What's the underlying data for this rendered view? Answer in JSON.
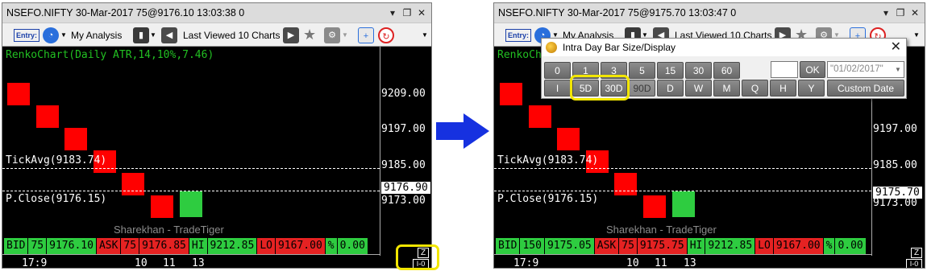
{
  "left": {
    "title": "NSEFO.NIFTY 30-Mar-2017 75@9176.10 13:03:38 0",
    "study_label": "RenkoChart(Daily ATR,14,10%,7.46)",
    "y_labels": [
      "9209.00",
      "9197.00",
      "9185.00",
      "9173.00"
    ],
    "price_marker": "9176.90",
    "tick_avg": "TickAvg(9183.74)",
    "prev_close": "P.Close(9176.15)",
    "quote": {
      "bid_label": "BID",
      "bid_qty": "75",
      "bid_price": "9176.10",
      "ask_label": "ASK",
      "ask_qty": "75",
      "ask_price": "9176.85",
      "hi_label": "HI",
      "hi_price": "9212.85",
      "lo_label": "LO",
      "lo_price": "9167.00",
      "pct_label": "%",
      "pct_value": "0.00"
    },
    "x_labels": [
      "17:9",
      "10",
      "11",
      "13"
    ],
    "z_label": "Z",
    "interval_label": "I-0"
  },
  "right": {
    "title": "NSEFO.NIFTY 30-Mar-2017 75@9175.70 13:03:47 0",
    "study_label": "RenkoCh",
    "y_labels": [
      "9197.00",
      "9185.00",
      "9173.00"
    ],
    "price_marker": "9175.70",
    "tick_avg": "TickAvg(9183.74)",
    "prev_close": "P.Close(9176.15)",
    "quote": {
      "bid_label": "BID",
      "bid_qty": "150",
      "bid_price": "9175.05",
      "ask_label": "ASK",
      "ask_qty": "75",
      "ask_price": "9175.75",
      "hi_label": "HI",
      "hi_price": "9212.85",
      "lo_label": "LO",
      "lo_price": "9167.00",
      "pct_label": "%",
      "pct_value": "0.00"
    },
    "x_labels": [
      "17:9",
      "10",
      "11",
      "13"
    ],
    "z_label": "Z",
    "interval_label": "I-0"
  },
  "toolbar": {
    "entry_label": "Entry:",
    "analysis_label": "My Analysis",
    "viewed_label": "Last Viewed 10 Charts",
    "window_controls": [
      "▾",
      "❐",
      "✕"
    ]
  },
  "watermark": "Sharekhan - TradeTiger",
  "dialog": {
    "title": "Intra Day Bar Size/Display",
    "close_label": "✕",
    "row1": [
      "0",
      "1",
      "3",
      "5",
      "15",
      "30",
      "60"
    ],
    "ok_label": "OK",
    "date_value": "\"01/02/2017\"",
    "row2": [
      "I",
      "5D",
      "30D",
      "90D",
      "D",
      "W",
      "M",
      "Q",
      "H",
      "Y"
    ],
    "custom_label": "Custom Date"
  },
  "colors": {
    "bull": "#2ecc40",
    "bear": "#ff0000",
    "highlight": "#f2e600",
    "arrow": "#1631e0"
  },
  "icons": [
    "entry-icon",
    "globe-icon",
    "chart-icon",
    "back-arrow-icon",
    "forward-arrow-icon",
    "star-icon",
    "settings-icon",
    "new-window-icon",
    "refresh-icon",
    "dropdown-icon",
    "coin-icon"
  ]
}
